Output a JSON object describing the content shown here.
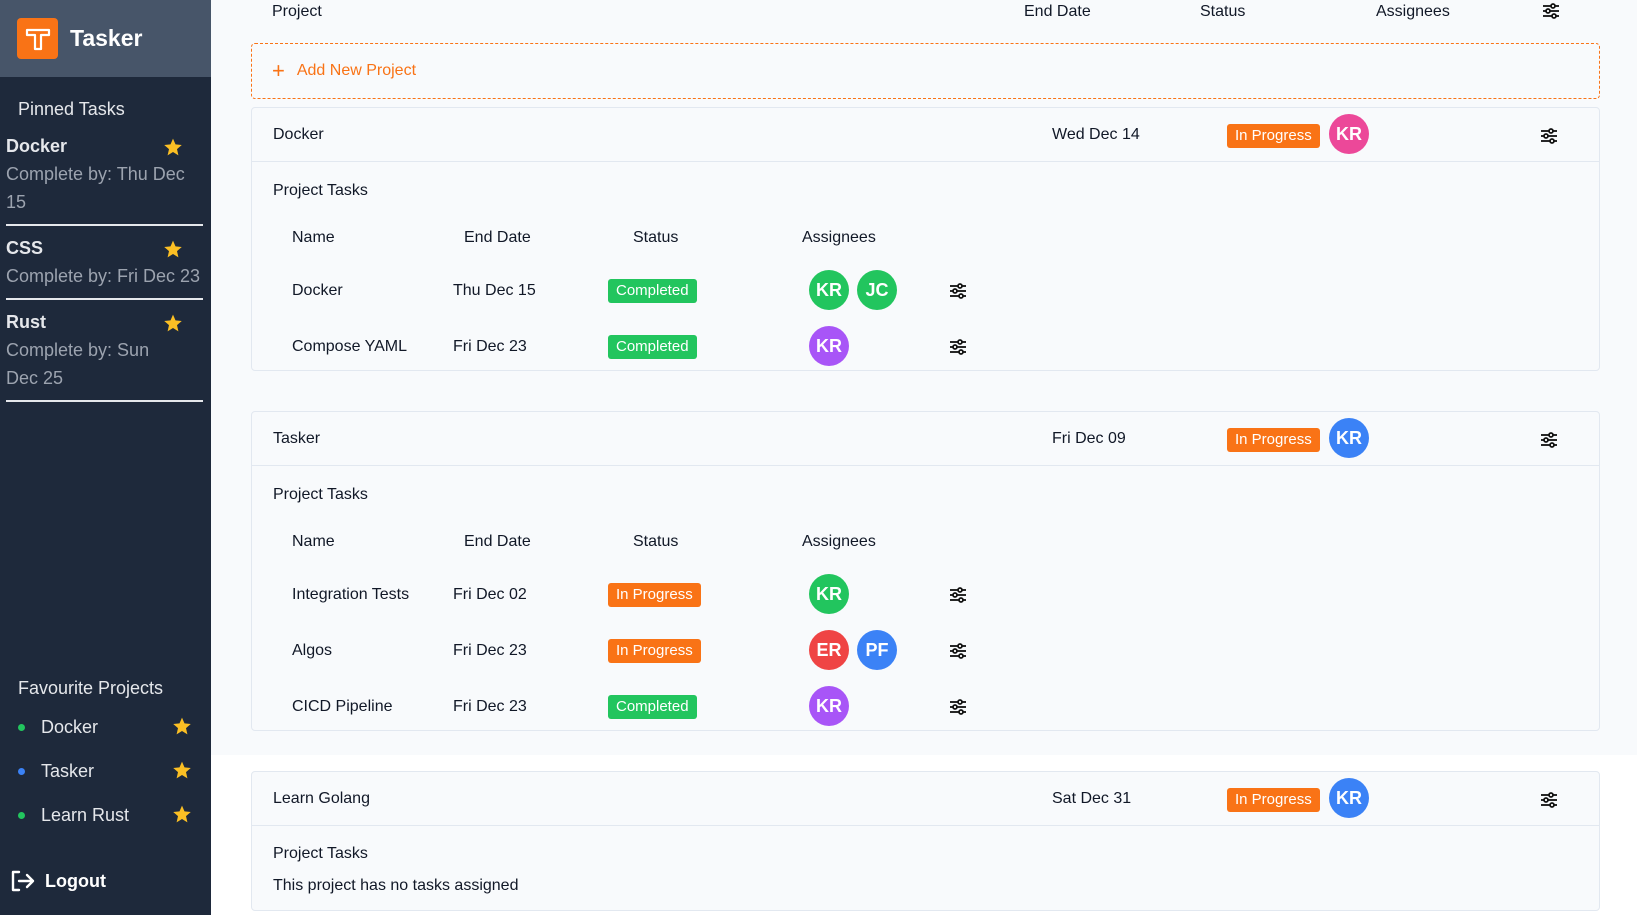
{
  "app": {
    "name": "Tasker"
  },
  "sidebar": {
    "pinned_heading": "Pinned Tasks",
    "pinned": [
      {
        "title": "Docker",
        "subtitle": "Complete by: Thu Dec 15"
      },
      {
        "title": "CSS",
        "subtitle": "Complete by: Fri Dec 23"
      },
      {
        "title": "Rust",
        "subtitle": "Complete by: Sun Dec 25"
      }
    ],
    "favourites_heading": "Favourite Projects",
    "favourites": [
      {
        "label": "Docker",
        "dot_color": "#22c55e"
      },
      {
        "label": "Tasker",
        "dot_color": "#3b82f6"
      },
      {
        "label": "Learn Rust",
        "dot_color": "#22c55e"
      }
    ],
    "logout_label": "Logout"
  },
  "header": {
    "project": "Project",
    "end_date": "End Date",
    "status": "Status",
    "assignees": "Assignees"
  },
  "add_project_label": "Add New Project",
  "task_columns": {
    "name": "Name",
    "end_date": "End Date",
    "status": "Status",
    "assignees": "Assignees"
  },
  "projects_tasks_title": "Project Tasks",
  "no_tasks_text": "This project has no tasks assigned",
  "projects": [
    {
      "name": "Docker",
      "end_date": "Wed Dec 14",
      "status": "In Progress",
      "assignee": {
        "initials": "KR",
        "color": "#ec4899"
      },
      "tasks": [
        {
          "name": "Docker",
          "end_date": "Thu Dec 15",
          "status": "Completed",
          "assignees": [
            {
              "initials": "KR",
              "color": "#22c55e"
            },
            {
              "initials": "JC",
              "color": "#22c55e"
            }
          ]
        },
        {
          "name": "Compose YAML",
          "end_date": "Fri Dec 23",
          "status": "Completed",
          "assignees": [
            {
              "initials": "KR",
              "color": "#a855f7"
            }
          ]
        }
      ]
    },
    {
      "name": "Tasker",
      "end_date": "Fri Dec 09",
      "status": "In Progress",
      "assignee": {
        "initials": "KR",
        "color": "#3b82f6"
      },
      "tasks": [
        {
          "name": "Integration Tests",
          "end_date": "Fri Dec 02",
          "status": "In Progress",
          "assignees": [
            {
              "initials": "KR",
              "color": "#22c55e"
            }
          ]
        },
        {
          "name": "Algos",
          "end_date": "Fri Dec 23",
          "status": "In Progress",
          "assignees": [
            {
              "initials": "ER",
              "color": "#ef4444"
            },
            {
              "initials": "PF",
              "color": "#3b82f6"
            }
          ]
        },
        {
          "name": "CICD Pipeline",
          "end_date": "Fri Dec 23",
          "status": "Completed",
          "assignees": [
            {
              "initials": "KR",
              "color": "#a855f7"
            }
          ]
        }
      ]
    },
    {
      "name": "Learn Golang",
      "end_date": "Sat Dec 31",
      "status": "In Progress",
      "assignee": {
        "initials": "KR",
        "color": "#3b82f6"
      },
      "tasks": []
    }
  ],
  "colors": {
    "accent": "#f97316",
    "completed": "#22c55e",
    "sidebar_bg": "#1e293b"
  }
}
